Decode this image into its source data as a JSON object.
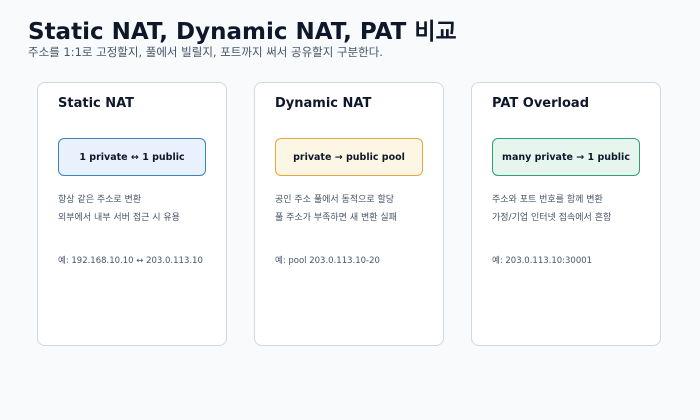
{
  "header": {
    "title": "Static NAT, Dynamic NAT, PAT 비교",
    "subtitle": "주소를 1:1로 고정할지, 풀에서 빌릴지, 포트까지 써서 공유할지 구분한다."
  },
  "cards": [
    {
      "title": "Static NAT",
      "mapping": "1 private ↔ 1 public",
      "mapping_bg": "#e8f1fc",
      "mapping_border": "#3b82c4",
      "desc_lines": [
        "항상 같은 주소로 변환",
        "외부에서 내부 서버 접근 시 유용"
      ],
      "example": "예: 192.168.10.10 ↔ 203.0.113.10"
    },
    {
      "title": "Dynamic NAT",
      "mapping": "private → public pool",
      "mapping_bg": "#fef6e4",
      "mapping_border": "#e5a93b",
      "desc_lines": [
        "공인 주소 풀에서 동적으로 할당",
        "풀 주소가 부족하면 새 변환 실패"
      ],
      "example": "예: pool 203.0.113.10-20"
    },
    {
      "title": "PAT Overload",
      "mapping": "many private → 1 public",
      "mapping_bg": "#e6f6ef",
      "mapping_border": "#2f9e72",
      "desc_lines": [
        "주소와 포트 번호를 함께 변환",
        "가정/기업 인터넷 접속에서 흔함"
      ],
      "example": "예: 203.0.113.10:30001"
    }
  ]
}
